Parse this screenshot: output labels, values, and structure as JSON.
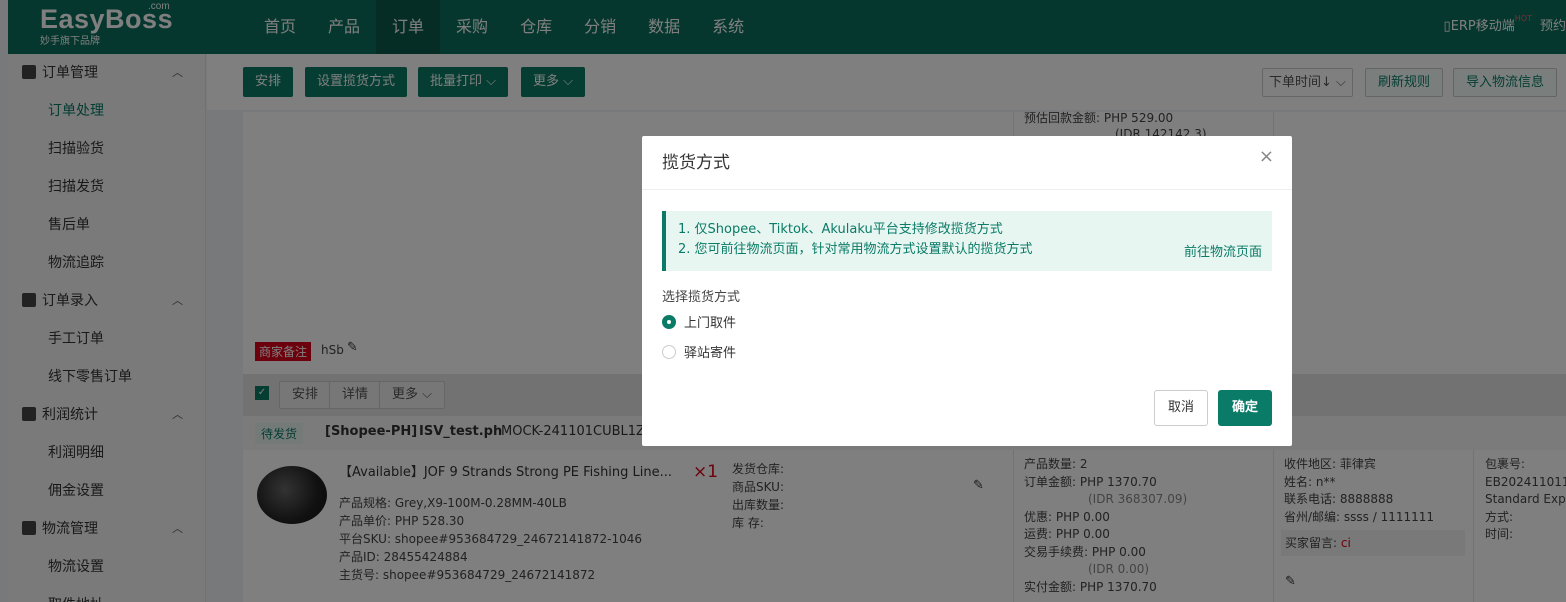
{
  "brand": {
    "name": "EasyBoss",
    "com": ".com",
    "sub": "妙手旗下品牌"
  },
  "nav": [
    "首页",
    "产品",
    "订单",
    "采购",
    "仓库",
    "分销",
    "数据",
    "系统"
  ],
  "topright": {
    "erp": "ERP移动端",
    "hot": "HOT",
    "more": "预约"
  },
  "sidebar": [
    {
      "group": "订单管理",
      "items": [
        "订单处理",
        "扫描验货",
        "扫描发货",
        "售后单",
        "物流追踪"
      ]
    },
    {
      "group": "订单录入",
      "items": [
        "手工订单",
        "线下零售订单"
      ]
    },
    {
      "group": "利润统计",
      "items": [
        "利润明细",
        "佣金设置"
      ]
    },
    {
      "group": "物流管理",
      "items": [
        "物流设置",
        "取件地址"
      ]
    }
  ],
  "toolbar": {
    "arrange": "安排",
    "set_pickup": "设置揽货方式",
    "batch_print": "批量打印",
    "more": "更多",
    "sort": "下单时间↓",
    "refresh": "刷新规则",
    "import": "导入物流信息"
  },
  "bg": {
    "refund_label": "预估回款金额:",
    "refund_val": "PHP 529.00",
    "refund_idr": "(IDR 142142.3)",
    "merchant_note_tag": "商家备注",
    "merchant_note": "hSb",
    "row_arrange": "安排",
    "row_detail": "详情",
    "row_more": "更多",
    "status": "待发货",
    "platform": "[Shopee-PH]",
    "shop": "ISV_test.ph",
    "order_no": "MOCK-241101CUBL1Z",
    "product_title": "【Available】JOF 9 Strands Strong PE Fishing Line...",
    "qty": "×1",
    "spec": "产品规格: Grey,X9-100M-0.28MM-40LB",
    "price": "产品单价: PHP 528.30",
    "sku": "平台SKU: shopee#953684729_24672141872-1046",
    "pid": "产品ID: 28455424884",
    "main_no": "主货号: shopee#953684729_24672141872",
    "wh1": "发货仓库:",
    "wh2": "商品SKU:",
    "wh3": "出库数量:",
    "wh4": "库    存:",
    "a1": "产品数量: 2",
    "a2": "订单金额: PHP 1370.70",
    "a3": "(IDR 368307.09)",
    "a4": "优惠: PHP 0.00",
    "a5": "运费: PHP 0.00",
    "a6": "交易手续费: PHP 0.00",
    "a7": "(IDR 0.00)",
    "a8": "实付金额: PHP 1370.70",
    "r1": "收件地区: 菲律宾",
    "r2": "姓名: n**",
    "r3": "联系电话: 8888888",
    "r4": "省州/邮编: ssss / 1111111",
    "r5": "买家留言: ",
    "r5v": "ci",
    "p1": "包裹号:",
    "p2": "EB202411011",
    "p3": "Standard Exp",
    "p4": "方式:",
    "p5": "时间:"
  },
  "modal": {
    "title": "揽货方式",
    "close": "×",
    "notice1": "1. 仅Shopee、Tiktok、Akulaku平台支持修改揽货方式",
    "notice2": "2. 您可前往物流页面，针对常用物流方式设置默认的揽货方式",
    "link": "前往物流页面",
    "label": "选择揽货方式",
    "opt1": "上门取件",
    "opt2": "驿站寄件",
    "cancel": "取消",
    "ok": "确定"
  }
}
